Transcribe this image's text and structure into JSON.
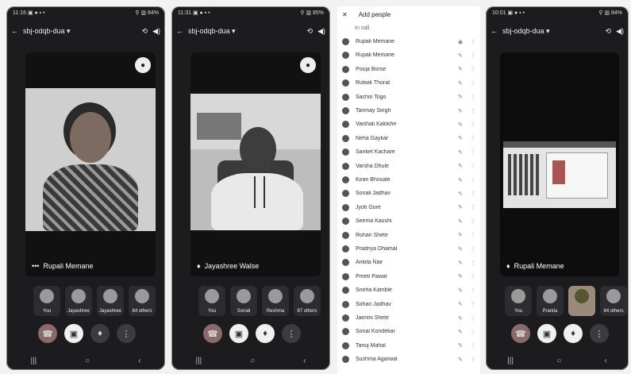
{
  "meeting": {
    "code": "sbj-odqb-dua ▾"
  },
  "screens": [
    {
      "tile_name": "Rupali Memane",
      "participants": [
        "You",
        "Jayashree",
        "Jayashree",
        "84 others"
      ]
    },
    {
      "tile_name": "Jayashree Walse",
      "participants": [
        "You",
        "Sonali",
        "Reshma",
        "87 others"
      ]
    },
    {
      "tile_name": "Rupali Memane",
      "participants": [
        "You",
        "Pranita",
        "",
        "84 others"
      ]
    }
  ],
  "participant_list": {
    "header": "Add people",
    "section": "In call",
    "rows": [
      {
        "name": "Rupali Memane",
        "status": "",
        "icon": "host-badge"
      },
      {
        "name": "Rupali Memane",
        "status": "",
        "icon": "mic-off-icon"
      },
      {
        "name": "Pooja Borse",
        "status": "",
        "icon": "mic-off-icon"
      },
      {
        "name": "Rutwik Thorat",
        "status": "",
        "icon": "mic-off-icon"
      },
      {
        "name": "Sachin Togo",
        "status": "",
        "icon": "mic-off-icon"
      },
      {
        "name": "Tanmay Singh",
        "status": "",
        "icon": "mic-off-icon"
      },
      {
        "name": "Vaishali Kalokhe",
        "status": "",
        "icon": "mic-off-icon"
      },
      {
        "name": "Neha Gaykar",
        "status": "",
        "icon": "mic-off-icon"
      },
      {
        "name": "Sanket Kachare",
        "status": "",
        "icon": "mic-off-icon"
      },
      {
        "name": "Varsha Dhule",
        "status": "",
        "icon": "mic-off-icon"
      },
      {
        "name": "Kiran Bhosale",
        "status": "",
        "icon": "mic-off-icon"
      },
      {
        "name": "Sonali Jadhav",
        "status": "",
        "icon": "mic-off-icon"
      },
      {
        "name": "Jyoti Gore",
        "status": "",
        "icon": "mic-off-icon"
      },
      {
        "name": "Seema Kaushi",
        "status": "",
        "icon": "mic-off-icon"
      },
      {
        "name": "Rohan Shete",
        "status": "",
        "icon": "mic-off-icon"
      },
      {
        "name": "Pradnya Dhamal",
        "status": "",
        "icon": "mic-off-icon"
      },
      {
        "name": "Ankita Nair",
        "status": "",
        "icon": "mic-off-icon"
      },
      {
        "name": "Preeti Pawar",
        "status": "",
        "icon": "mic-off-icon"
      },
      {
        "name": "Sneha Kamble",
        "status": "",
        "icon": "mic-off-icon"
      },
      {
        "name": "Sohan Jadhav",
        "status": "",
        "icon": "mic-off-icon"
      },
      {
        "name": "Jaimini Shete",
        "status": "",
        "icon": "mic-off-icon"
      },
      {
        "name": "Sonal Kondekar",
        "status": "",
        "icon": "mic-off-icon"
      },
      {
        "name": "Tanuj Mahal",
        "status": "",
        "icon": "mic-off-icon"
      },
      {
        "name": "Sushma Agarwal",
        "status": "",
        "icon": "mic-off-icon"
      }
    ]
  }
}
